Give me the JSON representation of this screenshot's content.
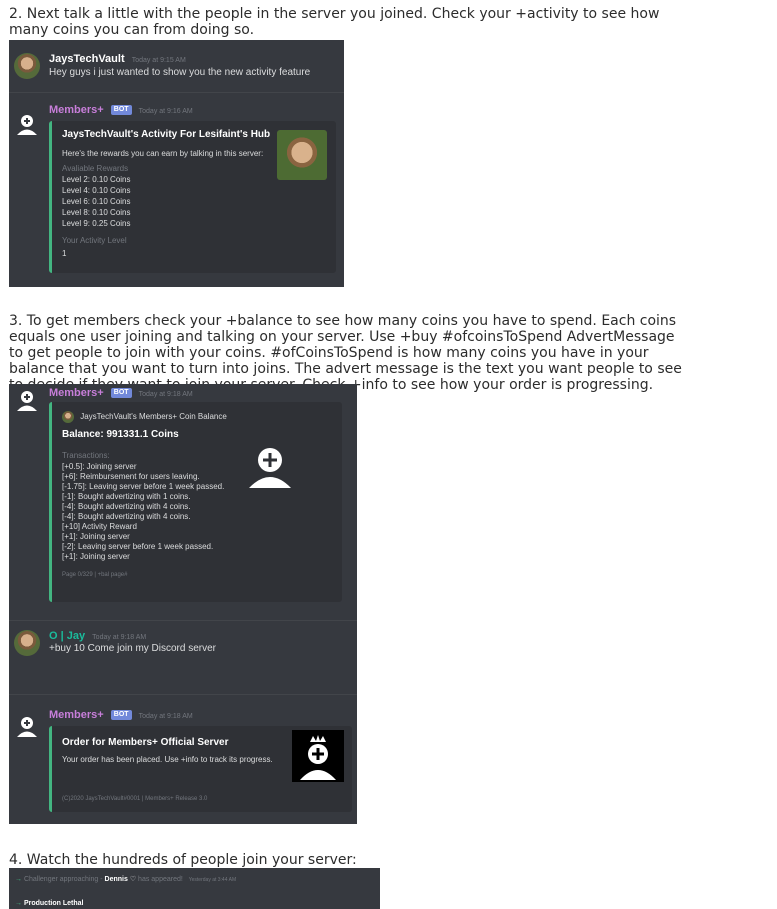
{
  "step2": {
    "line1": "2. Next talk a little with the people in the server you joined. Check your +activity to see how",
    "line2": "many coins you can from doing so."
  },
  "shot1": {
    "user_msg": {
      "author": "JaysTechVault",
      "time": "Today at 9:15 AM",
      "text": "Hey guys i just wanted to show you the new activity feature"
    },
    "bot_msg": {
      "author": "Members+",
      "badge": "BOT",
      "time": "Today at 9:16 AM",
      "embed": {
        "title": "JaysTechVault's Activity For Lesifaint's Hub",
        "desc": "Here's the rewards you can earn by talking in this server:",
        "rewards_label": "Avaliable Rewards",
        "rewards": [
          "Level 2: 0.10 Coins",
          "Level 4: 0.10 Coins",
          "Level 6: 0.10 Coins",
          "Level 8: 0.10 Coins",
          "Level 9: 0.25 Coins"
        ],
        "level_label": "Your Activity Level",
        "level_value": "1"
      }
    }
  },
  "step3": {
    "lines": [
      "3. To get members check your +balance to see how many coins you have to spend. Each coins",
      "equals one user joining and talking on your server. Use +buy #ofcoinsToSpend AdvertMessage",
      "to get people to join with your coins. #ofCoinsToSpend is how many coins you have in your",
      "balance that you want to turn into joins. The advert message is the text you want people to see",
      "to decide if they want to join your server. Check +info to see how your order is progressing."
    ]
  },
  "shot2": {
    "balance_msg": {
      "author": "Members+",
      "badge": "BOT",
      "time": "Today at 9:18 AM",
      "embed": {
        "author_line": "JaysTechVault's Members+ Coin Balance",
        "title": "Balance: 991331.1 Coins",
        "tx_label": "Transactions:",
        "transactions": [
          "[+0.5]: Joining server",
          "[+6]: Reimbursement for users leaving.",
          "[-1.75]: Leaving server before 1 week passed.",
          "[-1]: Bought advertizing with 1 coins.",
          "[-4]: Bought advertizing with 4 coins.",
          "[-4]: Bought advertizing with 4 coins.",
          "[+10] Activity Reward",
          "[+1]: Joining server",
          "[-2]: Leaving server before 1 week passed.",
          "[+1]: Joining server"
        ],
        "footer": "Page 0/329 | +bal page#"
      }
    },
    "user_msg": {
      "author": "O | Jay",
      "time": "Today at 9:18 AM",
      "text": "+buy 10 Come join my Discord server"
    },
    "order_msg": {
      "author": "Members+",
      "badge": "BOT",
      "time": "Today at 9:18 AM",
      "embed": {
        "title": "Order for Members+ Official Server",
        "desc": "Your order has been placed. Use +info to track its progress.",
        "footer": "(C)2020 JaysTechVault#0001 | Members+ Release 3.0"
      }
    }
  },
  "step4": {
    "line": "4. Watch the hundreds of people join your server:"
  },
  "shot3": {
    "join_line": {
      "prefix": "Challenger approaching -",
      "user": "Dennis",
      "suffix": "has appeared!",
      "time": "Yesterday at 3:44 AM"
    },
    "join_line2": {
      "text": "Production Lethal"
    }
  },
  "colors": {
    "discord_bg": "#36393f",
    "embed_bg": "#2f3136",
    "embed_border": "#43b581",
    "bot_name": "#c77ed9",
    "user_name": "#ffffff",
    "jay_name": "#1abc9c",
    "badge": "#7289da"
  }
}
